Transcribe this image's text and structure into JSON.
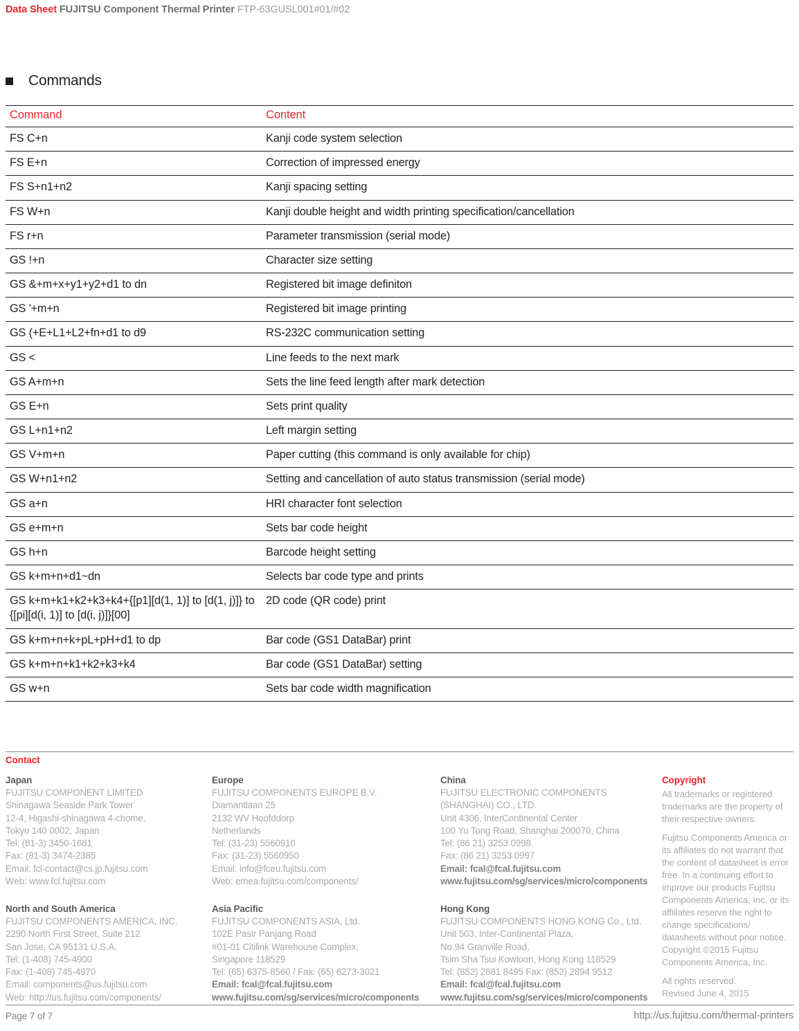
{
  "header": {
    "doc_type": "Data Sheet",
    "product": "FUJITSU Component Thermal Printer",
    "model": "FTP-63GUSL001#01/#02"
  },
  "section": {
    "title": "Commands"
  },
  "commands_table": {
    "columns": [
      "Command",
      "Content"
    ],
    "rows": [
      {
        "command": "FS C+n",
        "content": "Kanji code system selection"
      },
      {
        "command": "FS E+n",
        "content": "Correction of impressed energy"
      },
      {
        "command": "FS S+n1+n2",
        "content": "Kanji spacing setting"
      },
      {
        "command": "FS W+n",
        "content": "Kanji double height and width printing specification/cancellation"
      },
      {
        "command": "FS r+n",
        "content": "Parameter transmission (serial mode)"
      },
      {
        "command": "GS !+n",
        "content": "Character size setting"
      },
      {
        "command": "GS &+m+x+y1+y2+d1 to dn",
        "content": "Registered bit image definiton"
      },
      {
        "command": "GS '+m+n",
        "content": "Registered bit image printing"
      },
      {
        "command": "GS (+E+L1+L2+fn+d1 to d9",
        "content": "RS-232C communication setting"
      },
      {
        "command": "GS <",
        "content": "Line feeds to the next mark"
      },
      {
        "command": "GS A+m+n",
        "content": "Sets the line feed length after mark detection"
      },
      {
        "command": "GS E+n",
        "content": "Sets print quality"
      },
      {
        "command": "GS L+n1+n2",
        "content": "Left margin setting"
      },
      {
        "command": "GS V+m+n",
        "content": "Paper cutting (this command is only available for chip)"
      },
      {
        "command": "GS W+n1+n2",
        "content": "Setting and cancellation of auto status transmission (serial mode)"
      },
      {
        "command": "GS a+n",
        "content": "HRI character font selection"
      },
      {
        "command": "GS e+m+n",
        "content": "Sets bar code height"
      },
      {
        "command": "GS h+n",
        "content": "Barcode height setting"
      },
      {
        "command": "GS k+m+n+d1~dn",
        "content": "Selects bar code type and prints"
      },
      {
        "command": "GS k+m+k1+k2+k3+k4+{[p1][d(1, 1)] to [d(1, j)]} to {[pi][d(i, 1)] to [d(i, j)]}[00]",
        "content": "2D code (QR code) print",
        "tall": true
      },
      {
        "command": "GS k+m+n+k+pL+pH+d1 to dp",
        "content": "Bar code (GS1 DataBar) print"
      },
      {
        "command": "GS k+m+n+k1+k2+k3+k4",
        "content": "Bar code (GS1 DataBar) setting"
      },
      {
        "command": "GS w+n",
        "content": "Sets bar code width magnification"
      }
    ]
  },
  "contact": {
    "label": "Contact",
    "columns": [
      {
        "blocks": [
          {
            "title": "Japan",
            "lines": [
              "FUJITSU COMPONENT LIMITED",
              "Shinagawa Seaside Park Tower",
              "12-4, Higashi-shinagawa 4-chome,",
              "Tokyo 140 0002, Japan",
              "Tel: (81-3) 3450-1681",
              "Fax: (81-3) 3474-2385",
              "Email: fcl-contact@cs.jp.fujitsu.com",
              "Web: www.fcl.fujitsu.com"
            ]
          },
          {
            "title": "North and South America",
            "lines": [
              "FUJITSU COMPONENTS AMERICA, INC.",
              "2290 North First Street, Suite 212",
              "San Jose, CA  95131  U.S.A.",
              "Tel: (1-408) 745-4900",
              "Fax: (1-408) 745-4970",
              "Email: components@us.fujitsu.com",
              "Web: http://us.fujitsu.com/components/"
            ]
          }
        ]
      },
      {
        "blocks": [
          {
            "title": "Europe",
            "lines": [
              "FUJITSU COMPONENTS EUROPE B.V.",
              "Diamantlaan 25",
              "2132 WV Hoofddorp",
              "Netherlands",
              "Tel: (31-23) 5560910",
              "Fax: (31-23) 5560950",
              "Email: info@fceu.fujitsu.com",
              "Web: emea.fujitsu.com/components/"
            ]
          },
          {
            "title": "Asia Pacific",
            "lines": [
              "FUJITSU COMPONENTS ASIA, Ltd.",
              "102E Pasir Panjang Road",
              "#01-01 Citilink Warehouse Complex,",
              "Singapore  118529",
              "Tel: (65) 6375-8560 / Fax: (65) 6273-3021",
              {
                "text": "Email: fcal@fcal.fujitsu.com",
                "bold": true
              },
              {
                "text": "www.fujitsu.com/sg/services/micro/components",
                "bold": true
              }
            ]
          }
        ]
      },
      {
        "blocks": [
          {
            "title": "China",
            "lines": [
              "FUJITSU ELECTRONIC COMPONENTS",
              "(SHANGHAI) CO., LTD.",
              "Unit 4306, InterContinental Center",
              "100 Yu Tong Road, Shanghai 200070, China",
              "Tel: (86 21) 3253 0998",
              "Fax: (86 21) 3253 0997",
              {
                "text": "Email: fcal@fcal.fujitsu.com",
                "bold": true
              },
              {
                "text": "www.fujitsu.com/sg/services/micro/components",
                "bold": true
              }
            ]
          },
          {
            "title": "Hong Kong",
            "lines": [
              "FUJITSU COMPONENTS HONG KONG Co., Ltd.",
              "Unit 503, Inter-Continental Plaza,",
              "No.94 Granville Road,",
              "Tsim Sha Tsui Kowloon, Hong Kong  118529",
              "Tel: (852) 2881 8495   Fax: (852) 2894 9512",
              {
                "text": "Email: fcal@fcal.fujitsu.com",
                "bold": true
              },
              {
                "text": "www.fujitsu.com/sg/services/micro/components",
                "bold": true
              }
            ]
          }
        ]
      }
    ],
    "copyright": {
      "title": "Copyright",
      "paragraphs": [
        "All trademarks or registered trademarks are the property of their respective owners.",
        "Fujitsu Components America or its affiliates do not warrant that the content of datasheet is error free.  In a continuing effort to improve our products Fujitsu Components America, Inc. or its affiliates reserve the right to change specifications/ datasheets without prior notice. Copyright ©2015 Fujitsu Components America, Inc.",
        "All rights reserved.",
        "Revised  June 4, 2015"
      ]
    }
  },
  "footer": {
    "page_number": "Page 7 of 7",
    "url": "http://us.fujitsu.com/thermal-printers"
  },
  "colors": {
    "accent_red": "#e8252a",
    "text_dark": "#231f20",
    "text_gray": "#a7a9ac",
    "rule": "#808285"
  }
}
